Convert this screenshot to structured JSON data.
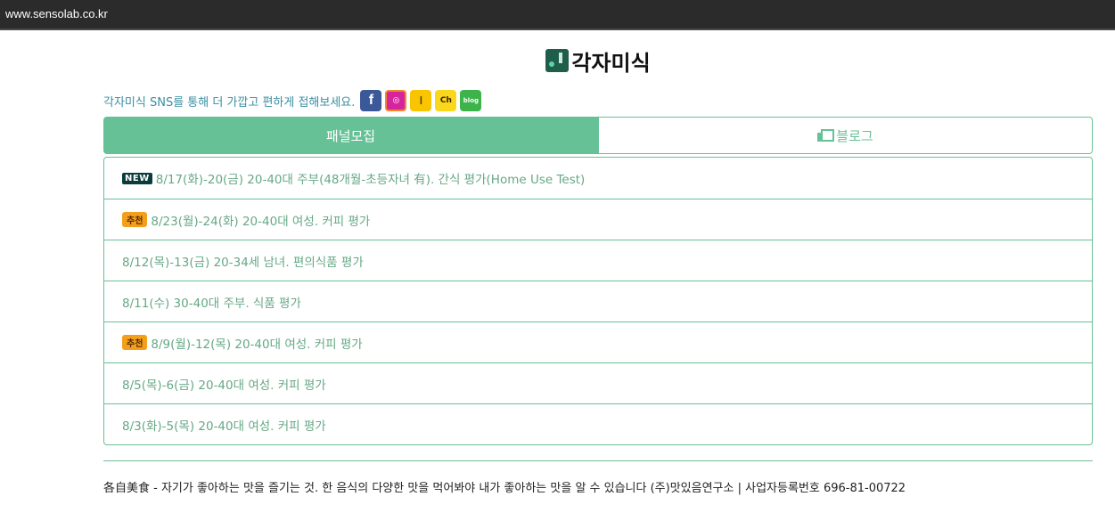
{
  "browser": {
    "url": "www.sensolab.co.kr"
  },
  "logo": {
    "text": "각자미식"
  },
  "sns": {
    "text": "각자미식 SNS를 통해 더 가깝고 편하게 접해보세요.",
    "icons": [
      {
        "name": "facebook-icon",
        "glyph": "f"
      },
      {
        "name": "instagram-icon",
        "glyph": "◎"
      },
      {
        "name": "kakaostory-icon",
        "glyph": "❙"
      },
      {
        "name": "kakaochannel-icon",
        "glyph": "Ch"
      },
      {
        "name": "blog-icon",
        "glyph": "blog"
      }
    ]
  },
  "tabs": {
    "panel": "패널모집",
    "blog": "블로그"
  },
  "badges": {
    "new": "NEW",
    "recommend": "추천"
  },
  "items": [
    {
      "badge": "new",
      "text": "8/17(화)-20(금) 20-40대 주부(48개월-초등자녀 有). 간식 평가(Home Use Test)"
    },
    {
      "badge": "recommend",
      "text": "8/23(월)-24(화) 20-40대 여성. 커피 평가"
    },
    {
      "badge": "",
      "text": "8/12(목)-13(금) 20-34세 남녀. 편의식품 평가"
    },
    {
      "badge": "",
      "text": "8/11(수) 30-40대 주부. 식품 평가"
    },
    {
      "badge": "recommend",
      "text": "8/9(월)-12(목) 20-40대 여성. 커피 평가"
    },
    {
      "badge": "",
      "text": "8/5(목)-6(금) 20-40대 여성. 커피 평가"
    },
    {
      "badge": "",
      "text": "8/3(화)-5(목) 20-40대 여성. 커피 평가"
    }
  ],
  "footer": {
    "text": "各自美食 - 자기가 좋아하는 맛을 즐기는 것. 한 음식의 다양한 맛을 먹어봐야 내가 좋아하는 맛을 알 수 있습니다 (주)맛있음연구소 | 사업자등록번호 696-81-00722"
  },
  "colors": {
    "accent": "#66c196",
    "link": "#66a886",
    "sns_text": "#3a8fa3",
    "urlbar": "#2b2b2b"
  }
}
